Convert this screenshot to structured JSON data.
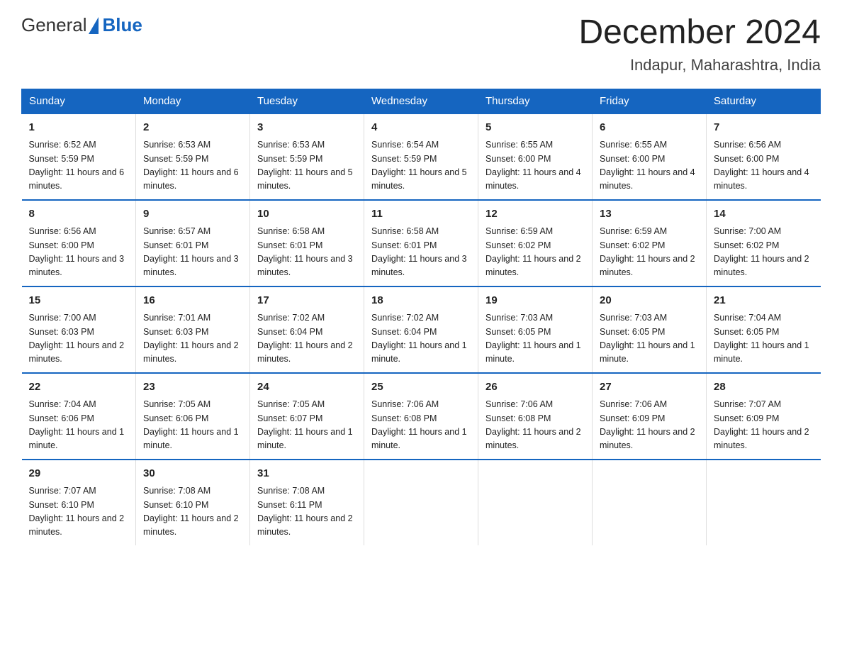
{
  "header": {
    "logo_general": "General",
    "logo_blue": "Blue",
    "title": "December 2024",
    "subtitle": "Indapur, Maharashtra, India"
  },
  "days_of_week": [
    "Sunday",
    "Monday",
    "Tuesday",
    "Wednesday",
    "Thursday",
    "Friday",
    "Saturday"
  ],
  "weeks": [
    [
      {
        "day": "1",
        "sunrise": "6:52 AM",
        "sunset": "5:59 PM",
        "daylight": "11 hours and 6 minutes."
      },
      {
        "day": "2",
        "sunrise": "6:53 AM",
        "sunset": "5:59 PM",
        "daylight": "11 hours and 6 minutes."
      },
      {
        "day": "3",
        "sunrise": "6:53 AM",
        "sunset": "5:59 PM",
        "daylight": "11 hours and 5 minutes."
      },
      {
        "day": "4",
        "sunrise": "6:54 AM",
        "sunset": "5:59 PM",
        "daylight": "11 hours and 5 minutes."
      },
      {
        "day": "5",
        "sunrise": "6:55 AM",
        "sunset": "6:00 PM",
        "daylight": "11 hours and 4 minutes."
      },
      {
        "day": "6",
        "sunrise": "6:55 AM",
        "sunset": "6:00 PM",
        "daylight": "11 hours and 4 minutes."
      },
      {
        "day": "7",
        "sunrise": "6:56 AM",
        "sunset": "6:00 PM",
        "daylight": "11 hours and 4 minutes."
      }
    ],
    [
      {
        "day": "8",
        "sunrise": "6:56 AM",
        "sunset": "6:00 PM",
        "daylight": "11 hours and 3 minutes."
      },
      {
        "day": "9",
        "sunrise": "6:57 AM",
        "sunset": "6:01 PM",
        "daylight": "11 hours and 3 minutes."
      },
      {
        "day": "10",
        "sunrise": "6:58 AM",
        "sunset": "6:01 PM",
        "daylight": "11 hours and 3 minutes."
      },
      {
        "day": "11",
        "sunrise": "6:58 AM",
        "sunset": "6:01 PM",
        "daylight": "11 hours and 3 minutes."
      },
      {
        "day": "12",
        "sunrise": "6:59 AM",
        "sunset": "6:02 PM",
        "daylight": "11 hours and 2 minutes."
      },
      {
        "day": "13",
        "sunrise": "6:59 AM",
        "sunset": "6:02 PM",
        "daylight": "11 hours and 2 minutes."
      },
      {
        "day": "14",
        "sunrise": "7:00 AM",
        "sunset": "6:02 PM",
        "daylight": "11 hours and 2 minutes."
      }
    ],
    [
      {
        "day": "15",
        "sunrise": "7:00 AM",
        "sunset": "6:03 PM",
        "daylight": "11 hours and 2 minutes."
      },
      {
        "day": "16",
        "sunrise": "7:01 AM",
        "sunset": "6:03 PM",
        "daylight": "11 hours and 2 minutes."
      },
      {
        "day": "17",
        "sunrise": "7:02 AM",
        "sunset": "6:04 PM",
        "daylight": "11 hours and 2 minutes."
      },
      {
        "day": "18",
        "sunrise": "7:02 AM",
        "sunset": "6:04 PM",
        "daylight": "11 hours and 1 minute."
      },
      {
        "day": "19",
        "sunrise": "7:03 AM",
        "sunset": "6:05 PM",
        "daylight": "11 hours and 1 minute."
      },
      {
        "day": "20",
        "sunrise": "7:03 AM",
        "sunset": "6:05 PM",
        "daylight": "11 hours and 1 minute."
      },
      {
        "day": "21",
        "sunrise": "7:04 AM",
        "sunset": "6:05 PM",
        "daylight": "11 hours and 1 minute."
      }
    ],
    [
      {
        "day": "22",
        "sunrise": "7:04 AM",
        "sunset": "6:06 PM",
        "daylight": "11 hours and 1 minute."
      },
      {
        "day": "23",
        "sunrise": "7:05 AM",
        "sunset": "6:06 PM",
        "daylight": "11 hours and 1 minute."
      },
      {
        "day": "24",
        "sunrise": "7:05 AM",
        "sunset": "6:07 PM",
        "daylight": "11 hours and 1 minute."
      },
      {
        "day": "25",
        "sunrise": "7:06 AM",
        "sunset": "6:08 PM",
        "daylight": "11 hours and 1 minute."
      },
      {
        "day": "26",
        "sunrise": "7:06 AM",
        "sunset": "6:08 PM",
        "daylight": "11 hours and 2 minutes."
      },
      {
        "day": "27",
        "sunrise": "7:06 AM",
        "sunset": "6:09 PM",
        "daylight": "11 hours and 2 minutes."
      },
      {
        "day": "28",
        "sunrise": "7:07 AM",
        "sunset": "6:09 PM",
        "daylight": "11 hours and 2 minutes."
      }
    ],
    [
      {
        "day": "29",
        "sunrise": "7:07 AM",
        "sunset": "6:10 PM",
        "daylight": "11 hours and 2 minutes."
      },
      {
        "day": "30",
        "sunrise": "7:08 AM",
        "sunset": "6:10 PM",
        "daylight": "11 hours and 2 minutes."
      },
      {
        "day": "31",
        "sunrise": "7:08 AM",
        "sunset": "6:11 PM",
        "daylight": "11 hours and 2 minutes."
      },
      null,
      null,
      null,
      null
    ]
  ]
}
